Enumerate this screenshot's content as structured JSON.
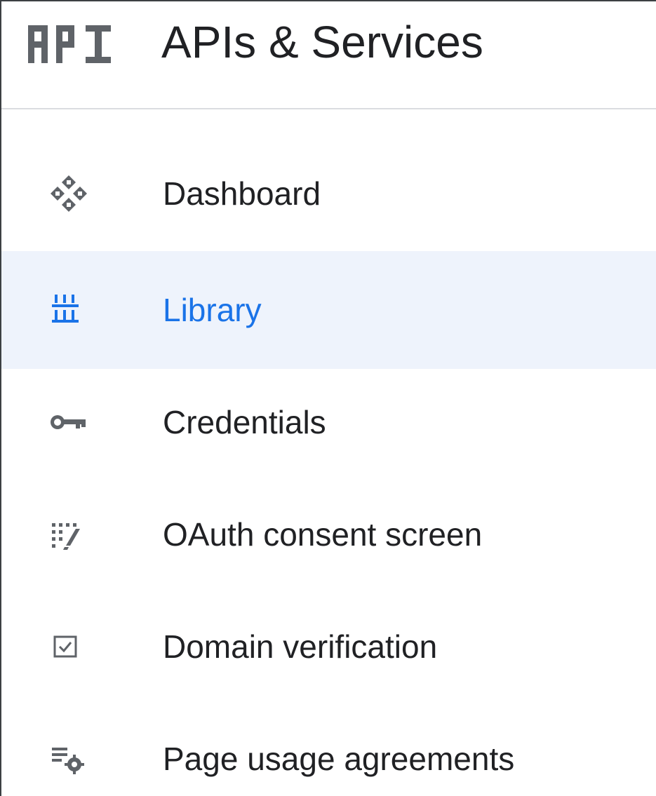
{
  "header": {
    "logo_icon": "api-logo-icon",
    "title": "APIs & Services"
  },
  "nav": {
    "items": [
      {
        "label": "Dashboard",
        "icon": "dashboard-icon",
        "active": false
      },
      {
        "label": "Library",
        "icon": "library-icon",
        "active": true
      },
      {
        "label": "Credentials",
        "icon": "key-icon",
        "active": false
      },
      {
        "label": "OAuth consent screen",
        "icon": "oauth-consent-icon",
        "active": false
      },
      {
        "label": "Domain verification",
        "icon": "checkbox-icon",
        "active": false
      },
      {
        "label": "Page usage agreements",
        "icon": "list-settings-icon",
        "active": false
      }
    ]
  },
  "colors": {
    "active_background": "#eef3fc",
    "active_text": "#1a73e8",
    "icon_gray": "#5f6368",
    "text": "#202124"
  }
}
